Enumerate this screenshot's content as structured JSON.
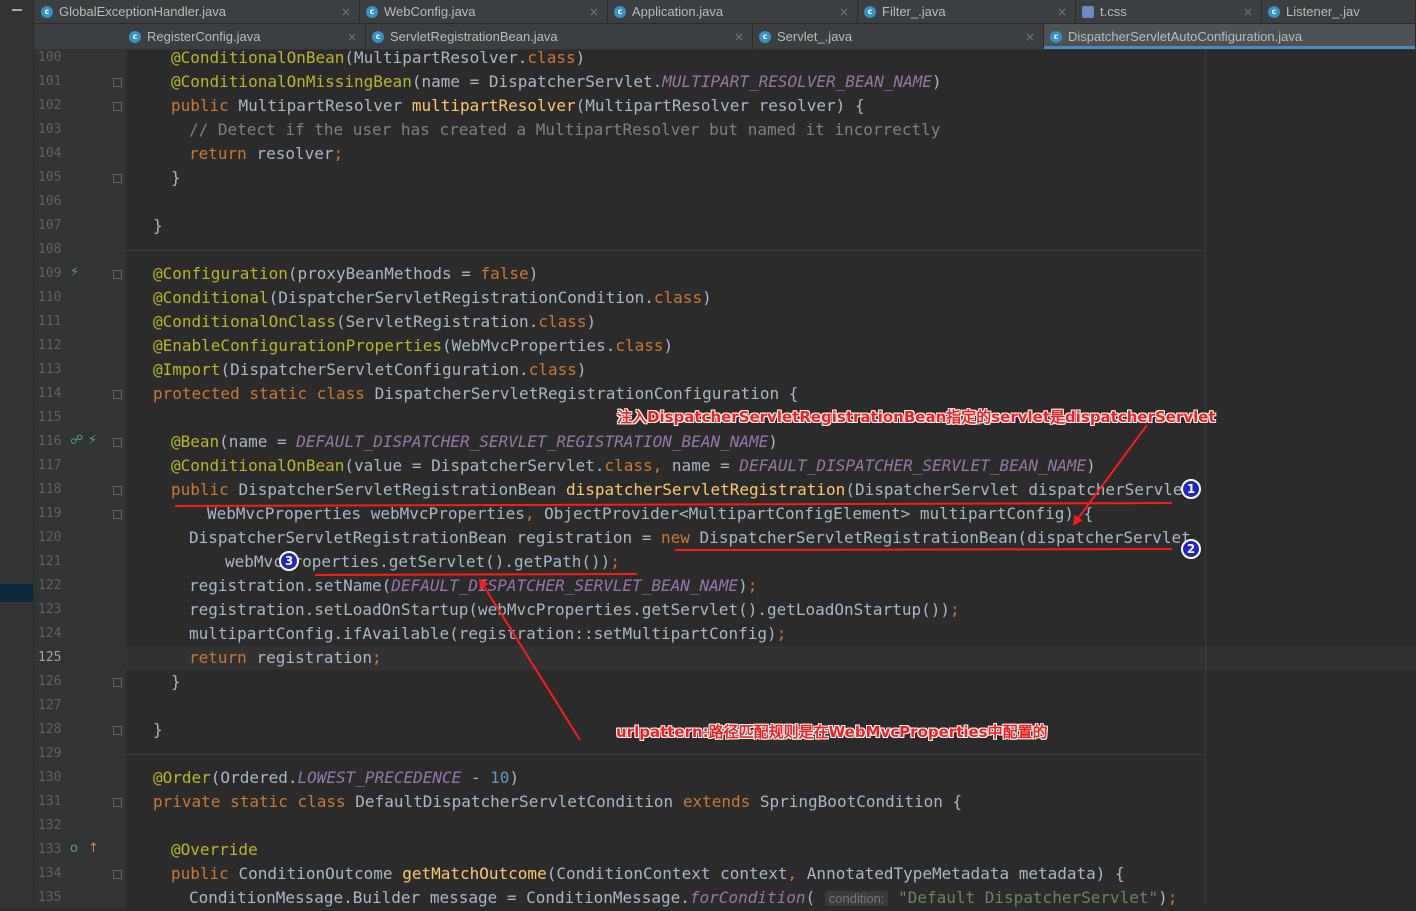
{
  "tabs_row1": [
    {
      "label": "GlobalExceptionHandler.java",
      "icon": "class-icon"
    },
    {
      "label": "WebConfig.java",
      "icon": "class-icon"
    },
    {
      "label": "Application.java",
      "icon": "class-icon"
    },
    {
      "label": "Filter_.java",
      "icon": "class-icon"
    },
    {
      "label": "t.css",
      "icon": "css-file-icon"
    },
    {
      "label": "Listener_.jav",
      "icon": "class-icon"
    }
  ],
  "tabs_row2": [
    {
      "label": "RegisterConfig.java",
      "icon": "class-icon"
    },
    {
      "label": "ServletRegistrationBean.java",
      "icon": "class-icon"
    },
    {
      "label": "Servlet_.java",
      "icon": "class-icon"
    },
    {
      "label": "DispatcherServletAutoConfiguration.java",
      "icon": "class-icon",
      "active": true
    }
  ],
  "close_glyph": "×",
  "editor": {
    "current_line": "125",
    "line_numbers": [
      "100",
      "101",
      "102",
      "103",
      "104",
      "105",
      "106",
      "107",
      "108",
      "109",
      "110",
      "111",
      "112",
      "113",
      "114",
      "115",
      "116",
      "117",
      "118",
      "119",
      "120",
      "121",
      "122",
      "123",
      "124",
      "125",
      "126",
      "127",
      "128",
      "129",
      "130",
      "131",
      "132",
      "133",
      "134",
      "135"
    ],
    "lines": [
      [
        [
          "a",
          "@ConditionalOnBean"
        ],
        [
          "t",
          "(MultipartResolver."
        ],
        [
          "k",
          "class"
        ],
        [
          "t",
          ")"
        ]
      ],
      [
        [
          "a",
          "@ConditionalOnMissingBean"
        ],
        [
          "t",
          "(name = DispatcherServlet."
        ],
        [
          "i",
          "MULTIPART_RESOLVER_BEAN_NAME"
        ],
        [
          "t",
          ")"
        ]
      ],
      [
        [
          "k",
          "public "
        ],
        [
          "t",
          "MultipartResolver "
        ],
        [
          "f",
          "multipartResolver"
        ],
        [
          "t",
          "(MultipartResolver resolver) {"
        ]
      ],
      [
        [
          "c",
          "// Detect if the user has created a MultipartResolver but named it incorrectly"
        ]
      ],
      [
        [
          "k",
          "return "
        ],
        [
          "t",
          "resolver"
        ],
        [
          "k",
          ";"
        ]
      ],
      [
        [
          "t",
          "}"
        ]
      ],
      [],
      [
        [
          "t",
          "}"
        ]
      ],
      [],
      [
        [
          "a",
          "@Configuration"
        ],
        [
          "t",
          "(proxyBeanMethods = "
        ],
        [
          "k",
          "false"
        ],
        [
          "t",
          ")"
        ]
      ],
      [
        [
          "a",
          "@Conditional"
        ],
        [
          "t",
          "(DispatcherServletRegistrationCondition."
        ],
        [
          "k",
          "class"
        ],
        [
          "t",
          ")"
        ]
      ],
      [
        [
          "a",
          "@ConditionalOnClass"
        ],
        [
          "t",
          "(ServletRegistration."
        ],
        [
          "k",
          "class"
        ],
        [
          "t",
          ")"
        ]
      ],
      [
        [
          "a",
          "@EnableConfigurationProperties"
        ],
        [
          "t",
          "(WebMvcProperties."
        ],
        [
          "k",
          "class"
        ],
        [
          "t",
          ")"
        ]
      ],
      [
        [
          "a",
          "@Import"
        ],
        [
          "t",
          "(DispatcherServletConfiguration."
        ],
        [
          "k",
          "class"
        ],
        [
          "t",
          ")"
        ]
      ],
      [
        [
          "k",
          "protected static class "
        ],
        [
          "t",
          "DispatcherServletRegistrationConfiguration {"
        ]
      ],
      [],
      [
        [
          "a",
          "@Bean"
        ],
        [
          "t",
          "(name = "
        ],
        [
          "i",
          "DEFAULT_DISPATCHER_SERVLET_REGISTRATION_BEAN_NAME"
        ],
        [
          "t",
          ")"
        ]
      ],
      [
        [
          "a",
          "@ConditionalOnBean"
        ],
        [
          "t",
          "(value = DispatcherServlet."
        ],
        [
          "k",
          "class, "
        ],
        [
          "t",
          "name = "
        ],
        [
          "i",
          "DEFAULT_DISPATCHER_SERVLET_BEAN_NAME"
        ],
        [
          "t",
          ")"
        ]
      ],
      [
        [
          "k",
          "public "
        ],
        [
          "t",
          "DispatcherServletRegistrationBean "
        ],
        [
          "f",
          "dispatcherServletRegistration"
        ],
        [
          "t",
          "(DispatcherServlet dispatcherServlet"
        ],
        [
          "k",
          ","
        ]
      ],
      [
        [
          "t",
          "WebMvcProperties webMvcProperties"
        ],
        [
          "k",
          ", "
        ],
        [
          "t",
          "ObjectProvider<MultipartConfigElement> multipartConfig) {"
        ]
      ],
      [
        [
          "t",
          "DispatcherServletRegistrationBean registration = "
        ],
        [
          "k",
          "new "
        ],
        [
          "t",
          "DispatcherServletRegistrationBean(dispatcherServlet"
        ],
        [
          "k",
          ","
        ]
      ],
      [
        [
          "t",
          "webMvcProperties.getServlet().getPath())"
        ],
        [
          "k",
          ";"
        ]
      ],
      [
        [
          "t",
          "registration.setName("
        ],
        [
          "i",
          "DEFAULT_DISPATCHER_SERVLET_BEAN_NAME"
        ],
        [
          "t",
          ")"
        ],
        [
          "k",
          ";"
        ]
      ],
      [
        [
          "t",
          "registration.setLoadOnStartup(webMvcProperties.getServlet().getLoadOnStartup())"
        ],
        [
          "k",
          ";"
        ]
      ],
      [
        [
          "t",
          "multipartConfig.ifAvailable(registration::setMultipartConfig)"
        ],
        [
          "k",
          ";"
        ]
      ],
      [
        [
          "k",
          "return "
        ],
        [
          "t",
          "registration"
        ],
        [
          "k",
          ";"
        ]
      ],
      [
        [
          "t",
          "}"
        ]
      ],
      [],
      [
        [
          "t",
          "}"
        ]
      ],
      [],
      [
        [
          "a",
          "@Order"
        ],
        [
          "t",
          "(Ordered."
        ],
        [
          "i",
          "LOWEST_PRECEDENCE"
        ],
        [
          "t",
          " - "
        ],
        [
          "n",
          "10"
        ],
        [
          "t",
          ")"
        ]
      ],
      [
        [
          "k",
          "private static class "
        ],
        [
          "t",
          "DefaultDispatcherServletCondition "
        ],
        [
          "k",
          "extends "
        ],
        [
          "t",
          "SpringBootCondition {"
        ]
      ],
      [],
      [
        [
          "a",
          "@Override"
        ]
      ],
      [
        [
          "k",
          "public "
        ],
        [
          "t",
          "ConditionOutcome "
        ],
        [
          "f",
          "getMatchOutcome"
        ],
        [
          "t",
          "(ConditionContext context"
        ],
        [
          "k",
          ", "
        ],
        [
          "t",
          "AnnotatedTypeMetadata metadata) {"
        ]
      ],
      [
        [
          "t",
          "ConditionMessage.Builder message = ConditionMessage."
        ],
        [
          "i",
          "forCondition"
        ],
        [
          "t",
          "( "
        ],
        [
          "h",
          "condition:"
        ],
        [
          "t",
          " "
        ],
        [
          "s",
          "\"Default DispatcherServlet\""
        ],
        [
          "t",
          ")"
        ],
        [
          "k",
          ";"
        ]
      ]
    ]
  },
  "annotations": {
    "note_top": "注入DispatcherServletRegistrationBean指定的servlet是dispatcherServlet",
    "note_bottom": "urlpattern:路径匹配规则是在WebMvcProperties中配置的",
    "badge1": "1",
    "badge2": "2",
    "badge3": "3",
    "color": "#ff1a1a"
  }
}
